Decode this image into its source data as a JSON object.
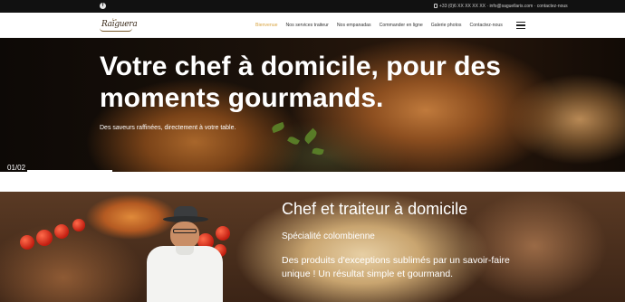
{
  "topbar": {
    "social_icon": "facebook-icon",
    "contact_text": "+33 (0)6 XX XX XX XX · info@saguellaris.com · contactez-nous"
  },
  "nav": {
    "logo_text": "Raiguera",
    "logo_small": "Le",
    "items": [
      {
        "label": "Bienvenue",
        "active": true
      },
      {
        "label": "Nos services traiteur",
        "active": false
      },
      {
        "label": "Nos empanadas",
        "active": false
      },
      {
        "label": "Commander en ligne",
        "active": false
      },
      {
        "label": "Galerie photos",
        "active": false
      },
      {
        "label": "Contactez-nous",
        "active": false
      }
    ],
    "menu_icon": "hamburger-icon",
    "accent_color": "#d9a441"
  },
  "hero": {
    "title": "Votre chef à domicile, pour des moments gourmands.",
    "subtitle": "Des saveurs raffinées, directement à votre table.",
    "slide_counter": "01/02",
    "slide_progress": 0.5
  },
  "section": {
    "heading": "Chef et traiteur à domicile",
    "specialty": "Spécialité colombienne",
    "description": "Des produits d'exceptions sublimés par un savoir-faire unique ! Un résultat simple et gourmand."
  }
}
